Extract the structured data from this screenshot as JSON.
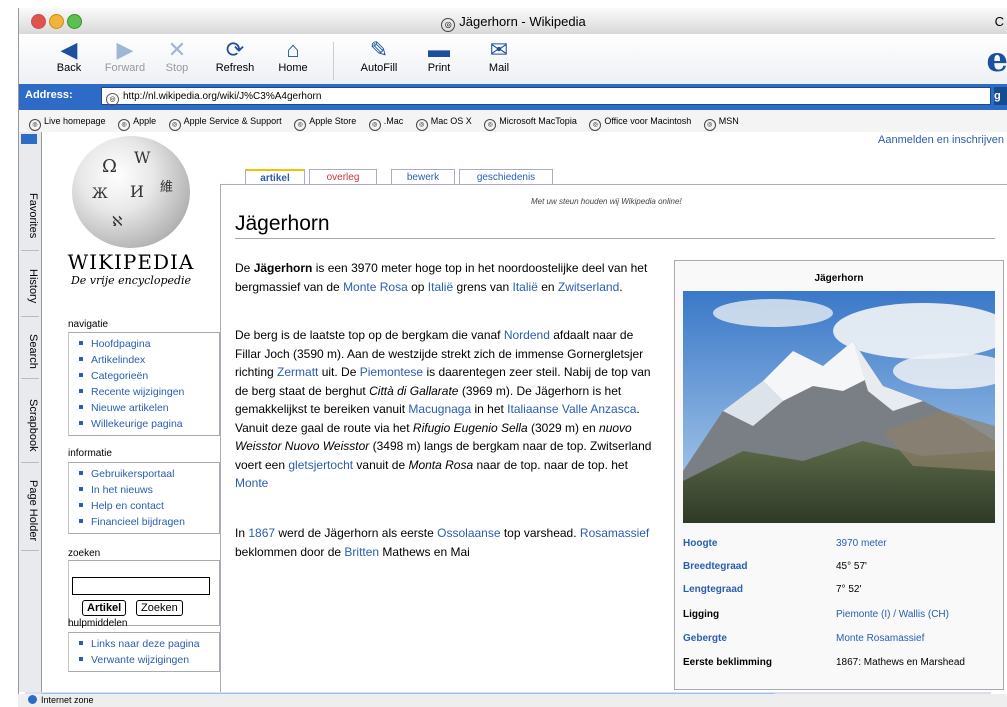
{
  "window": {
    "title": "Jägerhorn - Wikipedia",
    "right_fragment": "C"
  },
  "toolbar": {
    "back": "Back",
    "forward": "Forward",
    "stop": "Stop",
    "refresh": "Refresh",
    "home": "Home",
    "autofill": "AutoFill",
    "print": "Print",
    "mail": "Mail",
    "icons": {
      "back": "back-arrow-icon",
      "forward": "forward-arrow-icon",
      "stop": "stop-x-icon",
      "refresh": "refresh-icon",
      "home": "home-icon",
      "autofill": "autofill-icon",
      "print": "print-icon",
      "mail": "mail-icon"
    }
  },
  "address": {
    "label": "Address:",
    "url": "http://nl.wikipedia.org/wiki/J%C3%A4gerhorn",
    "go": "g"
  },
  "favorites": [
    "Live homepage",
    "Apple",
    "Apple Service & Support",
    "Apple Store",
    ".Mac",
    "Mac OS X",
    "Microsoft MacTopia",
    "Office voor Macintosh",
    "MSN"
  ],
  "sidetabs": [
    "Favorites",
    "History",
    "Search",
    "Scrapbook",
    "Page Holder"
  ],
  "wiki": {
    "wordmark": "WIKIPEDIA",
    "subtitle": "De vrije encyclopedie",
    "login": "Aanmelden en inschrijven",
    "tagline": "Met uw steun houden wij Wikipedia online!",
    "navigatie": {
      "title": "navigatie",
      "items": [
        "Hoofdpagina",
        "Artikelindex",
        "Categorieën",
        "Recente wijzigingen",
        "Nieuwe artikelen",
        "Willekeurige pagina"
      ]
    },
    "informatie": {
      "title": "informatie",
      "items": [
        "Gebruikersportaal",
        "In het nieuws",
        "Help en contact",
        "Financieel bijdragen"
      ]
    },
    "zoeken": {
      "title": "zoeken",
      "btn_article": "Artikel",
      "btn_search": "Zoeken"
    },
    "hulpmiddelen": {
      "title": "hulpmiddelen",
      "items": [
        "Links naar deze pagina",
        "Verwante wijzigingen"
      ]
    }
  },
  "tabs": [
    "artikel",
    "overleg",
    "bewerk",
    "geschiedenis"
  ],
  "article": {
    "title": "Jägerhorn",
    "p1": [
      {
        "t": "De "
      },
      {
        "t": "Jägerhorn",
        "b": true
      },
      {
        "t": " is een 3970 meter hoge top in het noordoostelijke deel van het bergmassief van de "
      },
      {
        "t": "Monte Rosa",
        "a": true
      },
      {
        "t": " op                          "
      },
      {
        "t": "Italië",
        "a": true
      },
      {
        "t": " grens van "
      },
      {
        "t": "Italië",
        "a": true
      },
      {
        "t": " en "
      },
      {
        "t": "Zwitserland",
        "a": true
      },
      {
        "t": "."
      }
    ],
    "p2": [
      {
        "t": "De berg is de laatste top op de bergkam die vanaf "
      },
      {
        "t": "Nordend",
        "a": true
      },
      {
        "t": " afdaalt naar de Fillar Joch (3590 m). Aan de westzijde strekt zich de immense Gornergletsjer richting "
      },
      {
        "t": "Zermatt",
        "a": true
      },
      {
        "t": " uit. De "
      },
      {
        "t": "Piemontese",
        "a": true
      },
      {
        "t": " is daarentegen zeer steil. Nabij de top van de berg staat de berghut "
      },
      {
        "t": "Città di Gallarate",
        "i": true
      },
      {
        "t": " (3969 m). De Jägerhorn is het gemakkelijkst te bereiken vanuit "
      },
      {
        "t": "Macugnaga",
        "a": true
      },
      {
        "t": " in het "
      },
      {
        "t": "Italiaanse Valle Anzasca",
        "a": true
      },
      {
        "t": ". Vanuit deze gaal de route via het "
      },
      {
        "t": "Rifugio Eugenio Sella",
        "i": true
      },
      {
        "t": " (3029 m) en "
      },
      {
        "t": "nuovo Weisstor Nuovo Weisstor",
        "i": true
      },
      {
        "t": " (3498 m) langs de bergkam naar de top. Zwitserland voert een "
      },
      {
        "t": "gletsjertocht",
        "a": true
      },
      {
        "t": " vanuit de "
      },
      {
        "t": "Monta Rosa",
        "i": true
      },
      {
        "t": " naar de top. naar de top.                                         het "
      },
      {
        "t": "Monte",
        "a": true
      }
    ],
    "p3": [
      {
        "t": "In "
      },
      {
        "t": "1867",
        "a": true
      },
      {
        "t": " werd de Jägerhorn als eerste "
      },
      {
        "t": "Ossolaanse",
        "a": true
      },
      {
        "t": " top varshead. "
      },
      {
        "t": "Rosamassief",
        "a": true
      },
      {
        "t": " beklommen door de "
      },
      {
        "t": "Britten",
        "a": true
      },
      {
        "t": " Mathews en Mai"
      }
    ]
  },
  "infobox": {
    "title": "Jägerhorn",
    "rows": [
      {
        "k": "Hoogte",
        "v": "3970 meter",
        "k_link": true,
        "v_link": true
      },
      {
        "k": "Breedtegraad",
        "v": "45° 57'",
        "k_link": true,
        "v_link": false
      },
      {
        "k": "Lengtegraad",
        "v": "7° 52'",
        "k_link": true,
        "v_link": false
      },
      {
        "k": "Ligging",
        "v": "Piemonte (I) / Wallis (CH)",
        "k_link": false,
        "v_link": true
      },
      {
        "k": "Gebergte",
        "v": "Monte Rosamassief",
        "k_link": true,
        "v_link": true
      },
      {
        "k": "Eerste beklimming",
        "v": "1867: Mathews en Marshead",
        "k_link": false,
        "v_link": false
      }
    ]
  },
  "status": {
    "zone": "Internet zone"
  }
}
